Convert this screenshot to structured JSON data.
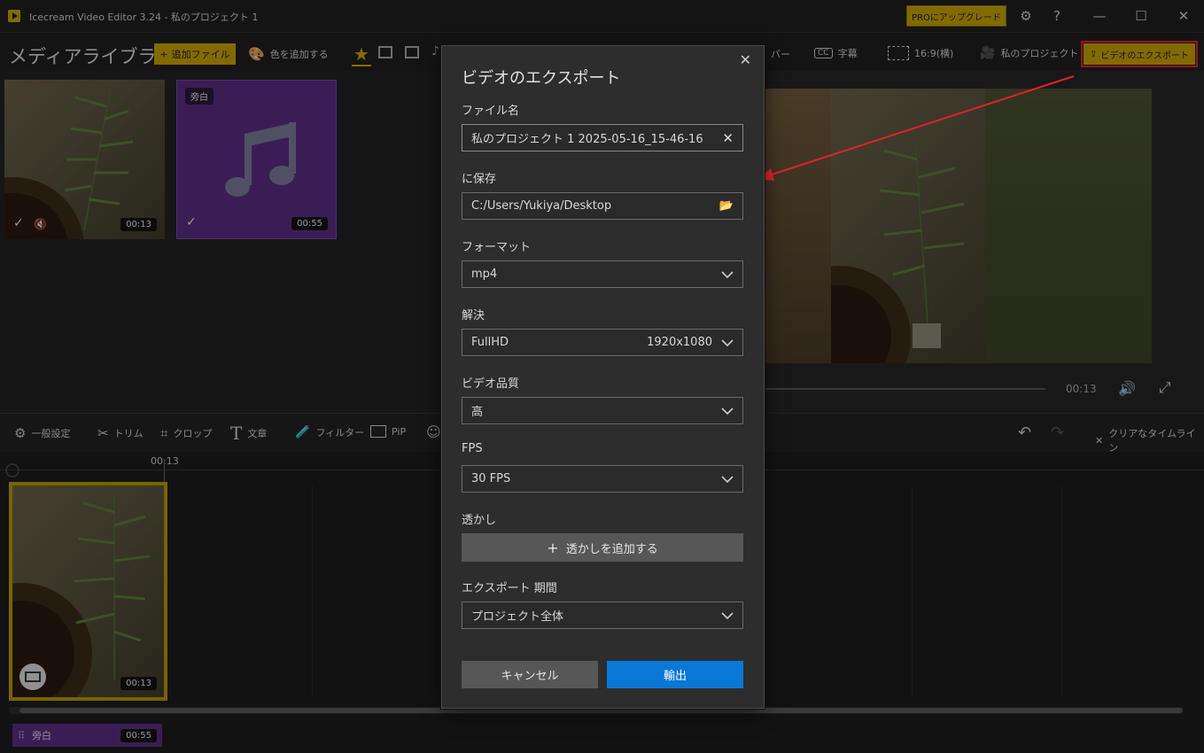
{
  "window": {
    "title": "Icecream Video Editor 3.24  -  私のプロジェクト 1",
    "pro_button": "PROにアップグレード",
    "settings_icon": "gear-icon",
    "help_icon": "question-icon"
  },
  "header": {
    "library_title": "メディアライブラリ",
    "add_file": "追加ファイル",
    "add_color": "色を追加する",
    "cover_partial": "バー",
    "subtitles": "字幕",
    "aspect": "16:9(横)",
    "project": "私のプロジェクト",
    "export_button": "ビデオのエクスポート"
  },
  "library": {
    "tiles": [
      {
        "duration": "00:13"
      },
      {
        "badge": "旁白",
        "duration": "00:55"
      }
    ]
  },
  "preview": {
    "time": "00:13"
  },
  "edit_toolbar": {
    "general": "一般設定",
    "trim": "トリム",
    "crop": "クロップ",
    "text": "文章",
    "filter": "フィルター",
    "pip": "PiP",
    "clear_timeline": "クリアなタイムライン"
  },
  "timeline": {
    "marker_time": "00:13",
    "clip_duration": "00:13",
    "audio_label": "旁白",
    "audio_duration": "00:55"
  },
  "modal": {
    "title": "ビデオのエクスポート",
    "filename_label": "ファイル名",
    "filename_value": "私のプロジェクト 1 2025-05-16_15-46-16",
    "save_label": "に保存",
    "save_path": "C:/Users/Yukiya/Desktop",
    "format_label": "フォーマット",
    "format_value": "mp4",
    "resolution_label": "解決",
    "resolution_value": "FullHD",
    "resolution_size": "1920x1080",
    "quality_label": "ビデオ品質",
    "quality_value": "高",
    "fps_label": "FPS",
    "fps_value": "30 FPS",
    "watermark_label": "透かし",
    "watermark_button": "透かしを追加する",
    "duration_label": "エクスポート 期間",
    "duration_value": "プロジェクト全体",
    "cancel": "キャンセル",
    "export": "輸出"
  },
  "colors": {
    "accent": "#c9a400",
    "export_blue": "#0a78d7",
    "highlight_red": "#e0222b",
    "audio_purple": "#5b2d84"
  }
}
